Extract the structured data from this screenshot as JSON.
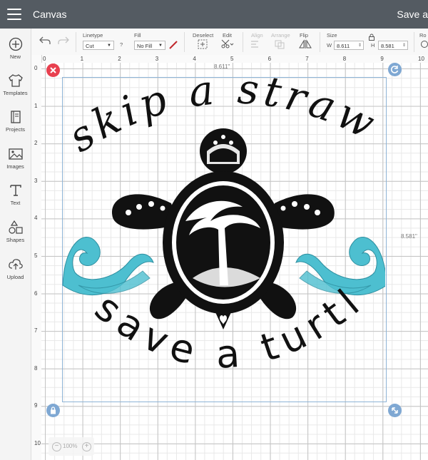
{
  "app": {
    "title": "Canvas",
    "save_label": "Save a"
  },
  "sidebar": {
    "items": [
      {
        "label": "New",
        "icon": "plus-circle-icon"
      },
      {
        "label": "Templates",
        "icon": "tshirt-icon"
      },
      {
        "label": "Projects",
        "icon": "projects-icon"
      },
      {
        "label": "Images",
        "icon": "image-icon"
      },
      {
        "label": "Text",
        "icon": "text-icon"
      },
      {
        "label": "Shapes",
        "icon": "shapes-icon"
      },
      {
        "label": "Upload",
        "icon": "upload-icon"
      }
    ]
  },
  "toolbar": {
    "linetype_label": "Linetype",
    "linetype_value": "Cut",
    "help": "?",
    "fill_label": "Fill",
    "fill_value": "No Fill",
    "deselect_label": "Deselect",
    "edit_label": "Edit",
    "align_label": "Align",
    "arrange_label": "Arrange",
    "flip_label": "Flip",
    "size_label": "Size",
    "w_label": "W",
    "w_value": "8.611",
    "h_label": "H",
    "h_value": "8.581",
    "rotate_label": "Ro",
    "pen_color": "#c0282d"
  },
  "rulers": {
    "horizontal": [
      "0",
      "1",
      "2",
      "3",
      "4",
      "5",
      "6",
      "7",
      "8",
      "9",
      "10"
    ],
    "vertical": [
      "0",
      "1",
      "2",
      "3",
      "4",
      "5",
      "6",
      "7",
      "8",
      "9",
      "10"
    ]
  },
  "selection": {
    "width_label": "8.611\"",
    "height_label": "8.581\""
  },
  "artwork": {
    "top_text": "skip a straw",
    "bottom_text": "save a turtle",
    "main_color": "#111111",
    "wave_color": "#4dbfd0"
  },
  "zoom": {
    "value": "100%",
    "minus": "−",
    "plus": "+"
  },
  "colors": {
    "topbar": "#545b62",
    "delete_handle": "#e8404f",
    "handle": "#7fa8d3"
  }
}
